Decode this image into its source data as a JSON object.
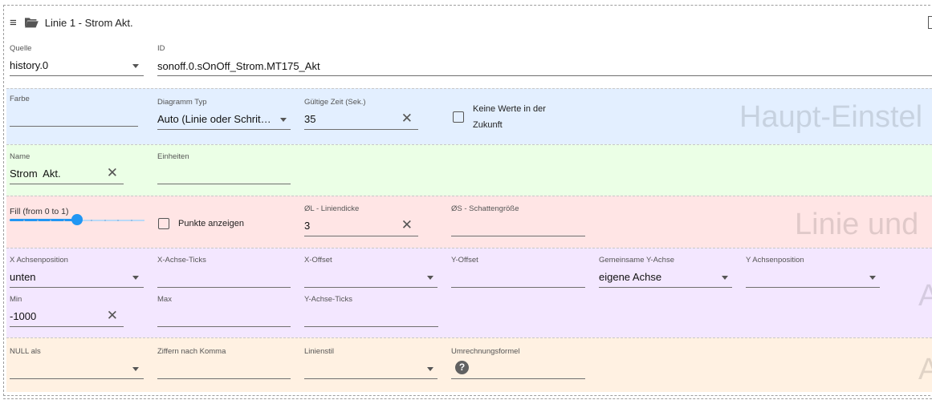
{
  "header": {
    "title": "Linie 1 - Strom Akt.",
    "menu_icon": "≡"
  },
  "source": {
    "label": "Quelle",
    "value": "history.0"
  },
  "id_field": {
    "label": "ID",
    "value": "sonoff.0.sOnOff_Strom.MT175_Akt"
  },
  "main_settings": {
    "watermark": "Haupt-Einstel",
    "color": {
      "label": "Farbe",
      "value": ""
    },
    "chart_type": {
      "label": "Diagramm Typ",
      "value": "Auto (Linie oder Schrit…"
    },
    "valid_time": {
      "label": "Gültige Zeit (Sek.)",
      "value": "35"
    },
    "no_future": {
      "label_line1": "Keine Werte in der",
      "label_line2": "Zukunft",
      "checked": false
    }
  },
  "name_section": {
    "name": {
      "label": "Name",
      "value": "Strom  Akt."
    },
    "units": {
      "label": "Einheiten",
      "value": ""
    }
  },
  "line_section": {
    "watermark": "Linie und",
    "fill": {
      "label": "Fill (from 0 to 1)",
      "value": 0.5
    },
    "show_points": {
      "label": "Punkte anzeigen",
      "checked": false
    },
    "line_width": {
      "label": "ØL - Liniendicke",
      "value": "3"
    },
    "shadow_size": {
      "label": "ØS - Schattengröße",
      "value": ""
    }
  },
  "axis_section": {
    "watermark": "A",
    "x_axis_position": {
      "label": "X Achsenposition",
      "value": "unten"
    },
    "x_axis_ticks": {
      "label": "X-Achse-Ticks",
      "value": ""
    },
    "x_offset": {
      "label": "X-Offset",
      "value": ""
    },
    "y_offset": {
      "label": "Y-Offset",
      "value": ""
    },
    "common_y_axis": {
      "label": "Gemeinsame Y-Achse",
      "value": "eigene Achse"
    },
    "y_axis_position": {
      "label": "Y Achsenposition",
      "value": ""
    },
    "min": {
      "label": "Min",
      "value": "-1000"
    },
    "max": {
      "label": "Max",
      "value": ""
    },
    "y_axis_ticks": {
      "label": "Y-Achse-Ticks",
      "value": ""
    }
  },
  "misc_section": {
    "watermark": "A",
    "null_as": {
      "label": "NULL als",
      "value": ""
    },
    "decimals": {
      "label": "Ziffern nach Komma",
      "value": ""
    },
    "line_style": {
      "label": "Linienstil",
      "value": ""
    },
    "conversion": {
      "label": "Umrechnungsformel",
      "help": "?"
    }
  },
  "colors": {
    "accent": "#2196f3",
    "blue_band": "#e3efff",
    "green_band": "#ebffe6",
    "red_band": "#ffe5e5",
    "purple_band": "#f3e7ff",
    "orange_band": "#fff1e2"
  },
  "icons": {
    "menu": "menu-icon",
    "folder": "folder-open-icon",
    "clear": "close-icon",
    "dropdown": "chevron-down-icon",
    "help": "help-icon"
  }
}
